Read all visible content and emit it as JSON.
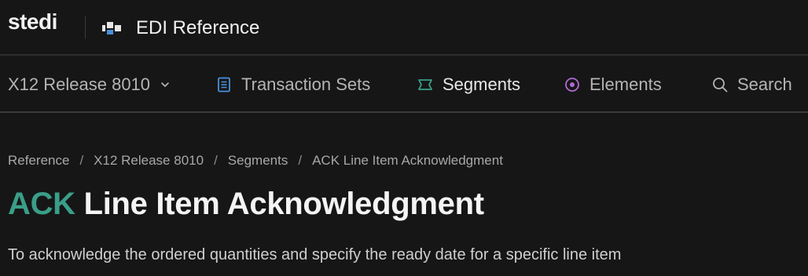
{
  "brand": {
    "logo": "stedi",
    "app_title": "EDI Reference"
  },
  "nav": {
    "release_label": "X12 Release 8010",
    "items": [
      {
        "label": "Transaction Sets",
        "icon": "document-icon",
        "color": "#4a90d9"
      },
      {
        "label": "Segments",
        "icon": "segment-icon",
        "color": "#3a9e88",
        "active": true
      },
      {
        "label": "Elements",
        "icon": "target-icon",
        "color": "#b06ad6"
      }
    ],
    "search_label": "Search"
  },
  "breadcrumb": [
    "Reference",
    "X12 Release 8010",
    "Segments",
    "ACK Line Item Acknowledgment"
  ],
  "breadcrumb_separator": "/",
  "page": {
    "code": "ACK",
    "title": "Line Item Acknowledgment",
    "description": "To acknowledge the ordered quantities and specify the ready date for a specific line item"
  },
  "colors": {
    "background": "#161616",
    "accent": "#3a9e88"
  }
}
